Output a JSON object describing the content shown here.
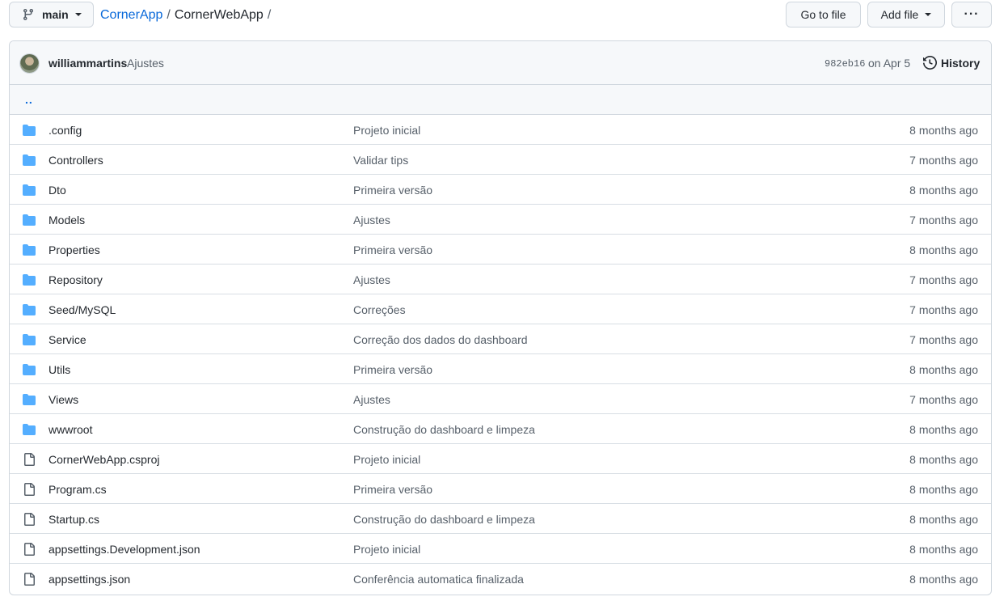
{
  "toolbar": {
    "branch": "main",
    "repo_owner": "CornerApp",
    "repo_path": "CornerWebApp",
    "separator": "/",
    "goto_label": "Go to file",
    "addfile_label": "Add file",
    "more_label": "···"
  },
  "commit": {
    "author": "williammartins",
    "message": "Ajustes",
    "sha": "982eb16",
    "date": "on Apr 5",
    "history_label": "History"
  },
  "parent": {
    "label": ".."
  },
  "files": [
    {
      "type": "folder",
      "name": ".config",
      "message": "Projeto inicial",
      "age": "8 months ago"
    },
    {
      "type": "folder",
      "name": "Controllers",
      "message": "Validar tips",
      "age": "7 months ago"
    },
    {
      "type": "folder",
      "name": "Dto",
      "message": "Primeira versão",
      "age": "8 months ago"
    },
    {
      "type": "folder",
      "name": "Models",
      "message": "Ajustes",
      "age": "7 months ago"
    },
    {
      "type": "folder",
      "name": "Properties",
      "message": "Primeira versão",
      "age": "8 months ago"
    },
    {
      "type": "folder",
      "name": "Repository",
      "message": "Ajustes",
      "age": "7 months ago"
    },
    {
      "type": "folder",
      "name": "Seed/MySQL",
      "message": "Correções",
      "age": "7 months ago"
    },
    {
      "type": "folder",
      "name": "Service",
      "message": "Correção dos dados do dashboard",
      "age": "7 months ago"
    },
    {
      "type": "folder",
      "name": "Utils",
      "message": "Primeira versão",
      "age": "8 months ago"
    },
    {
      "type": "folder",
      "name": "Views",
      "message": "Ajustes",
      "age": "7 months ago"
    },
    {
      "type": "folder",
      "name": "wwwroot",
      "message": "Construção do dashboard e limpeza",
      "age": "8 months ago"
    },
    {
      "type": "file",
      "name": "CornerWebApp.csproj",
      "message": "Projeto inicial",
      "age": "8 months ago"
    },
    {
      "type": "file",
      "name": "Program.cs",
      "message": "Primeira versão",
      "age": "8 months ago"
    },
    {
      "type": "file",
      "name": "Startup.cs",
      "message": "Construção do dashboard e limpeza",
      "age": "8 months ago"
    },
    {
      "type": "file",
      "name": "appsettings.Development.json",
      "message": "Projeto inicial",
      "age": "8 months ago"
    },
    {
      "type": "file",
      "name": "appsettings.json",
      "message": "Conferência automatica finalizada",
      "age": "8 months ago"
    }
  ],
  "colors": {
    "folder": "#54aeff",
    "file": "#57606a",
    "link": "#0969da"
  }
}
